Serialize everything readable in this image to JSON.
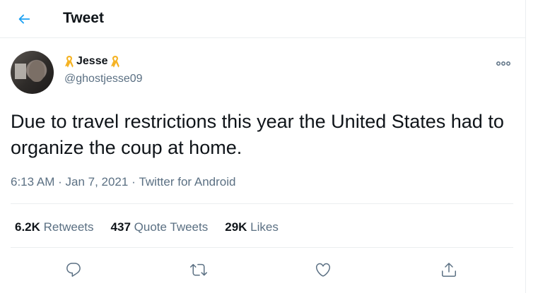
{
  "header": {
    "title": "Tweet",
    "back_icon": "arrow-left-icon",
    "accent_color": "#1da1f2"
  },
  "tweet": {
    "author": {
      "name": "Jesse",
      "handle": "@ghostjesse09",
      "name_decoration_icon": "yellow-ribbon-icon",
      "ribbon_color": "#f5b324"
    },
    "text": "Due to travel restrictions this year the United States had to organize the coup at home.",
    "time": "6:13 AM",
    "date": "Jan 7, 2021",
    "separator": " · ",
    "source": "Twitter for Android",
    "stats": {
      "retweets_count": "6.2K",
      "retweets_label": "Retweets",
      "quotes_count": "437",
      "quotes_label": "Quote Tweets",
      "likes_count": "29K",
      "likes_label": "Likes"
    },
    "actions": [
      {
        "icon": "reply-icon"
      },
      {
        "icon": "retweet-icon"
      },
      {
        "icon": "like-heart-icon"
      },
      {
        "icon": "share-icon"
      }
    ]
  },
  "colors": {
    "text_primary": "#0f1419",
    "text_secondary": "#5b7083",
    "border": "#ebeef0"
  }
}
